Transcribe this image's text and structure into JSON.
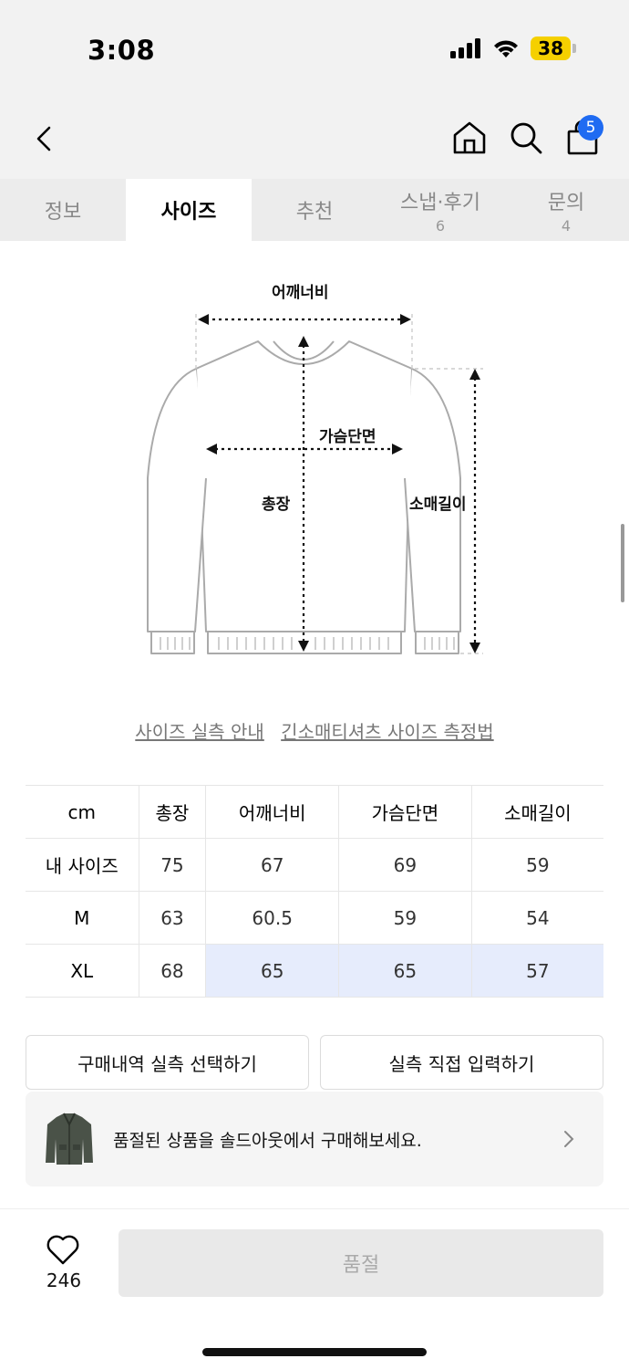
{
  "status_bar": {
    "time": "3:08",
    "battery": "38"
  },
  "nav": {
    "cart_count": "5"
  },
  "tabs": [
    {
      "label": "정보",
      "count": ""
    },
    {
      "label": "사이즈",
      "count": ""
    },
    {
      "label": "추천",
      "count": ""
    },
    {
      "label": "스냅·후기",
      "count": "6"
    },
    {
      "label": "문의",
      "count": "4"
    }
  ],
  "active_tab_index": 1,
  "diagram": {
    "shoulder": "어깨너비",
    "chest": "가슴단면",
    "length": "총장",
    "sleeve": "소매길이"
  },
  "links": {
    "guide": "사이즈 실측 안내",
    "method": "긴소매티셔츠 사이즈 측정법"
  },
  "size_table": {
    "headers": [
      "cm",
      "총장",
      "어깨너비",
      "가슴단면",
      "소매길이"
    ],
    "rows": [
      {
        "label": "내 사이즈",
        "values": [
          "75",
          "67",
          "69",
          "59"
        ]
      },
      {
        "label": "M",
        "values": [
          "63",
          "60.5",
          "59",
          "54"
        ]
      },
      {
        "label": "XL",
        "values": [
          "68",
          "65",
          "65",
          "57"
        ]
      }
    ]
  },
  "buttons": {
    "purchase_history": "구매내역 실측 선택하기",
    "manual_input": "실측 직접 입력하기"
  },
  "soldout_banner": {
    "text": "품절된 상품을 솔드아웃에서 구매해보세요."
  },
  "bottom": {
    "like_count": "246",
    "soldout_label": "품절"
  }
}
